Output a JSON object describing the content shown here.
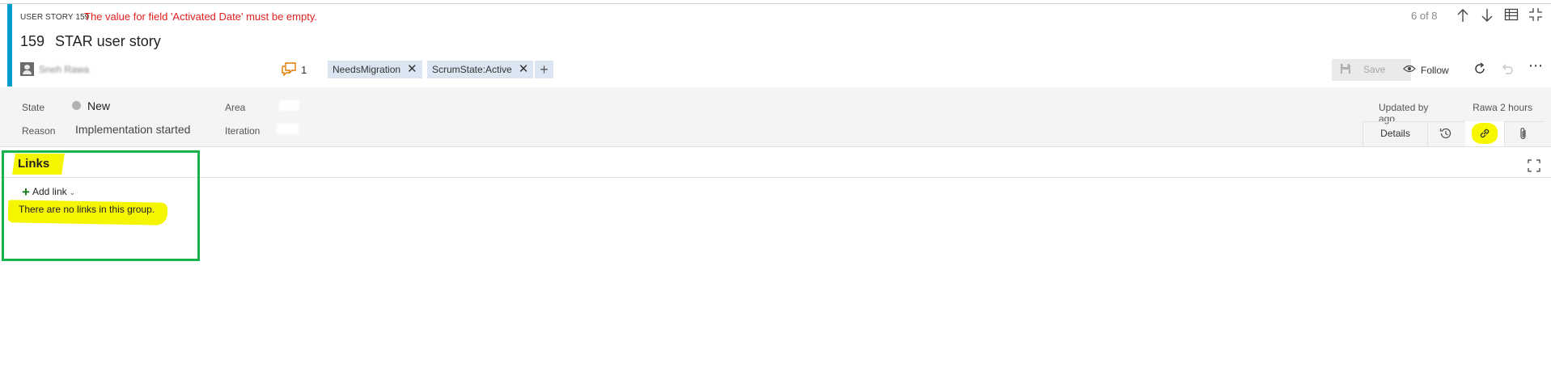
{
  "header": {
    "work_item_type": "USER STORY 159",
    "error_message": "The value for field 'Activated Date' must be empty.",
    "id": "159",
    "title": "STAR user story",
    "assignee": "Sneh Rawa",
    "discussion_count": "1",
    "tags": [
      "NeedsMigration",
      "ScrumState:Active"
    ],
    "tag_add": "+",
    "save_label": "Save",
    "follow_label": "Follow",
    "more_label": "⋯",
    "nav_counter": "6 of 8"
  },
  "fields": {
    "state_label": "State",
    "state_value": "New",
    "reason_label": "Reason",
    "reason_value": "Implementation started",
    "area_label": "Area",
    "iteration_label": "Iteration",
    "updated_prefix": "Updated by",
    "updated_suffix": "Rawa 2 hours ago"
  },
  "tabs": {
    "details": "Details"
  },
  "links_section": {
    "title": "Links",
    "add_link_label": "Add link",
    "add_link_plus": "+",
    "add_link_chevron": "⌄",
    "empty_message": "There are no links in this group."
  },
  "colors": {
    "accent": "#009ccc",
    "error": "#e01f1f",
    "highlight": "#f5f500",
    "annotation_box": "#19b24b",
    "tag_bg": "#dce6f2"
  }
}
